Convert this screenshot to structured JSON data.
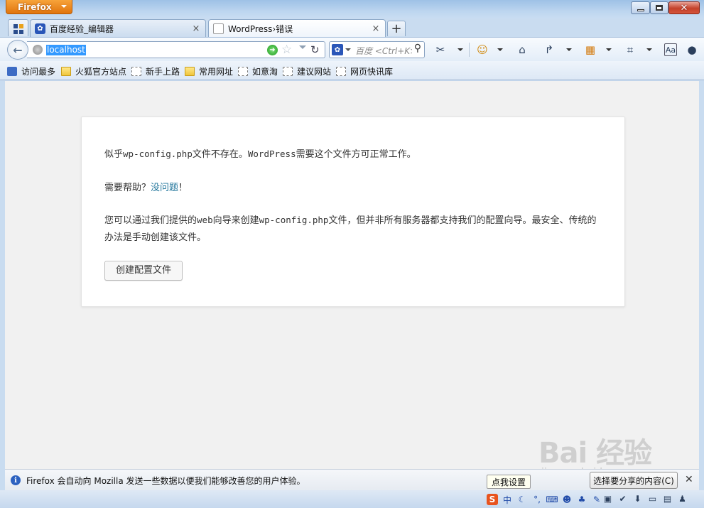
{
  "window": {
    "app_menu_label": "Firefox",
    "close_glyph": "✕"
  },
  "tabs": [
    {
      "label": "百度经验_编辑器",
      "favicon": "paw-icon",
      "selected": false
    },
    {
      "label": "WordPress›错误",
      "favicon": "blank-page-icon",
      "selected": true
    }
  ],
  "navbar": {
    "url": "localhost",
    "search_placeholder": "百度 <Ctrl+K>",
    "search_engine_icon": "paw-icon"
  },
  "bookmarks": [
    {
      "label": "访问最多",
      "icon": "most-visited-icon"
    },
    {
      "label": "火狐官方站点",
      "icon": "folder-icon"
    },
    {
      "label": "新手上路",
      "icon": "page-icon"
    },
    {
      "label": "常用网址",
      "icon": "folder-icon"
    },
    {
      "label": "如意淘",
      "icon": "page-icon"
    },
    {
      "label": "建议网站",
      "icon": "page-icon"
    },
    {
      "label": "网页快讯库",
      "icon": "page-icon"
    }
  ],
  "page": {
    "p1_a": "似乎",
    "p1_file": "wp-config.php",
    "p1_b": "文件不存在。",
    "p1_wp": "WordPress",
    "p1_c": "需要这个文件方可正常工作。",
    "help_prefix": "需要帮助？",
    "help_link": "没问题",
    "help_suffix": "！",
    "p3_a": "您可以通过我们提供的",
    "p3_web": "web",
    "p3_b": "向导来创建",
    "p3_file": "wp-config.php",
    "p3_c": "文件，但并非所有服务器都支持我们的配置向导。最安全、传统的办法是手动创建该文件。",
    "create_button": "创建配置文件"
  },
  "notification": {
    "text": "Firefox 会自动向 Mozilla 发送一些数据以便我们能够改善您的用户体验。",
    "choose_button": "选择要分享的内容(C)",
    "close": "✕"
  },
  "ime": {
    "tooltip": "点我设置",
    "mode": "中"
  },
  "watermark": {
    "text": "Bai 经验",
    "sub": "jingyan.baidu.com"
  },
  "colors": {
    "link": "#21759b",
    "firefox_orange": "#e0740d",
    "url_highlight": "#3399ff"
  }
}
